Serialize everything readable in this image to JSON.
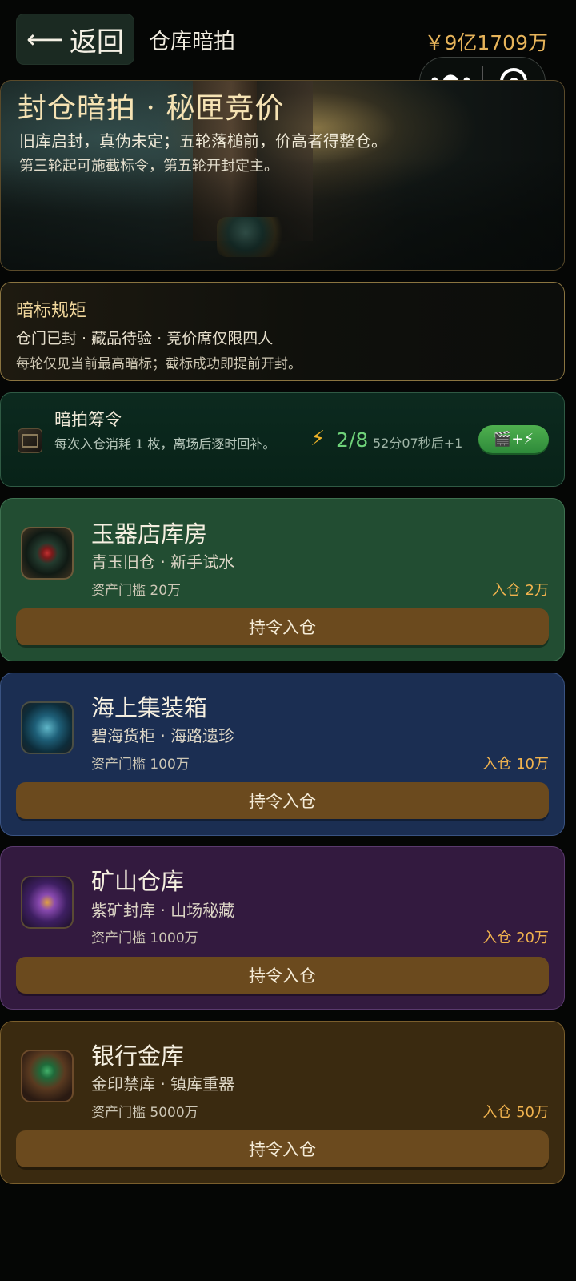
{
  "header": {
    "back_label": "返回",
    "title": "仓库暗拍",
    "balance": "￥9亿1709万",
    "menu_icon": "more-dots-icon",
    "close_icon": "target-icon"
  },
  "hero": {
    "title": "封仓暗拍 · 秘匣竞价",
    "line1": "旧库启封，真伪未定；五轮落槌前，价高者得整仓。",
    "line2": "第三轮起可施截标令，第五轮开封定主。"
  },
  "rules": {
    "title": "暗标规矩",
    "line1": "仓门已封 · 藏品待验 · 竞价席仅限四人",
    "line2": "每轮仅见当前最高暗标；截标成功即提前开封。"
  },
  "token": {
    "title": "暗拍筹令",
    "desc": "每次入仓消耗 1 枚，离场后逐时回补。",
    "bolt": "⚡",
    "count": "2/8",
    "timer": "52分07秒后+1",
    "ad_label": "🎬+⚡"
  },
  "vaults": [
    {
      "name": "玉器店库房",
      "tags": "青玉旧仓 · 新手试水",
      "threshold": "资产门槛 20万",
      "fee": "入仓 2万",
      "button": "持令入仓"
    },
    {
      "name": "海上集装箱",
      "tags": "碧海货柜 · 海路遗珍",
      "threshold": "资产门槛 100万",
      "fee": "入仓 10万",
      "button": "持令入仓"
    },
    {
      "name": "矿山仓库",
      "tags": "紫矿封库 · 山场秘藏",
      "threshold": "资产门槛 1000万",
      "fee": "入仓 20万",
      "button": "持令入仓"
    },
    {
      "name": "银行金库",
      "tags": "金印禁库 · 镇库重器",
      "threshold": "资产门槛 5000万",
      "fee": "入仓 50万",
      "button": "持令入仓"
    }
  ],
  "colors": {
    "accent_gold": "#e6b35a",
    "token_green": "#6fd37a",
    "button_brown": "#6b4a1e"
  }
}
